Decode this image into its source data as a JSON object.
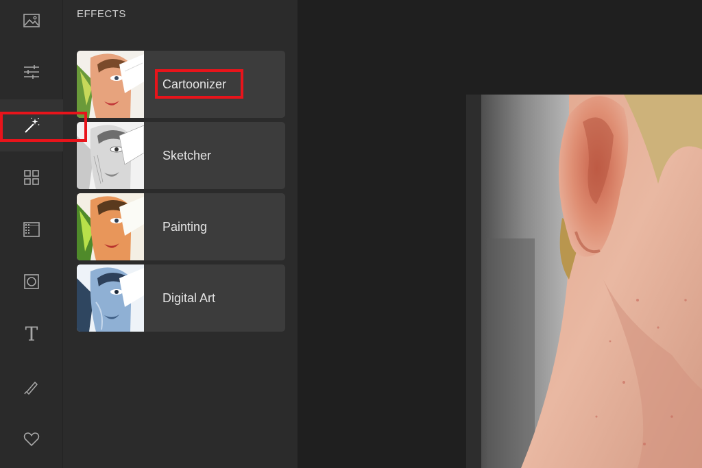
{
  "panel": {
    "title": "EFFECTS",
    "effects": [
      {
        "label": "Cartoonizer",
        "thumb_style": "cartoon"
      },
      {
        "label": "Sketcher",
        "thumb_style": "sketch"
      },
      {
        "label": "Painting",
        "thumb_style": "painting"
      },
      {
        "label": "Digital Art",
        "thumb_style": "digital"
      }
    ]
  },
  "toolbar": {
    "tools": [
      {
        "icon": "image-icon"
      },
      {
        "icon": "sliders-icon"
      },
      {
        "icon": "magic-wand-icon",
        "active": true
      },
      {
        "icon": "grid-icon"
      },
      {
        "icon": "texture-icon"
      },
      {
        "icon": "frame-icon"
      },
      {
        "icon": "text-icon",
        "glyph": "T"
      },
      {
        "icon": "brush-icon"
      },
      {
        "icon": "heart-icon"
      }
    ]
  },
  "colors": {
    "toolbar_bg": "#2a2a2a",
    "panel_bg": "#2b2b2b",
    "card_bg": "#3c3c3c",
    "canvas_bg": "#1f1f1f",
    "highlight": "#e8141b",
    "icon": "#a9a9a9"
  }
}
